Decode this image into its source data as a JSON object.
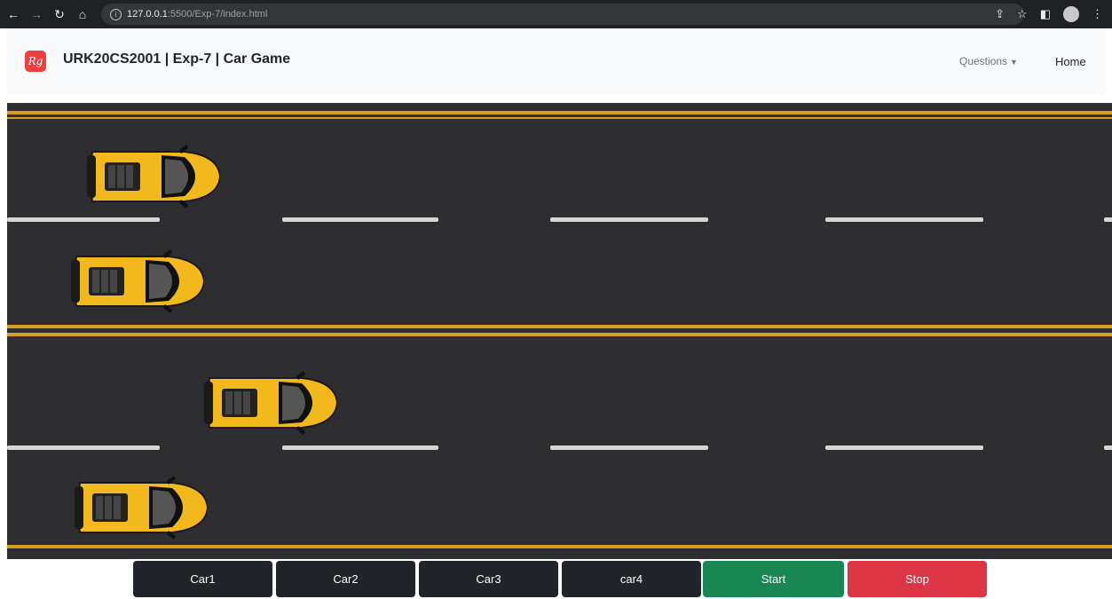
{
  "browser": {
    "url_host": "127.0.0.1",
    "url_path": ":5500/Exp-7/index.html"
  },
  "navbar": {
    "logo_text": "Rg",
    "brand": "URK20CS2001 | Exp-7 | Car Game",
    "questions_label": "Questions",
    "home_label": "Home"
  },
  "controls": {
    "car1": "Car1",
    "car2": "Car2",
    "car3": "Car3",
    "car4": "car4",
    "start": "Start",
    "stop": "Stop"
  },
  "colors": {
    "car_body": "#f2b81c",
    "road": "#2e2e30",
    "lane_yellow": "#d89c1e",
    "start": "#198754",
    "stop": "#dc3545"
  }
}
